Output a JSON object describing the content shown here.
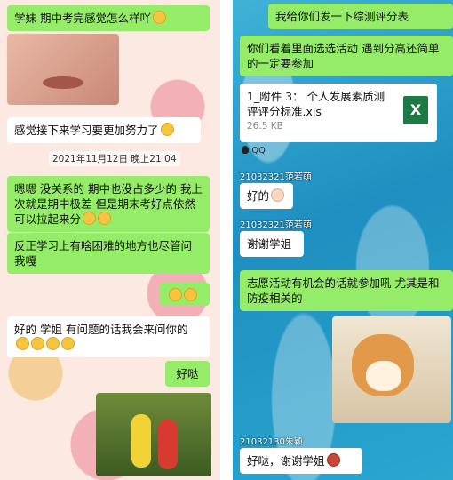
{
  "left": {
    "msg1": "学妹 期中考完感觉怎么样吖",
    "msg2": "感觉接下来学习要更加努力了",
    "timestamp": "2021年11月12日 晚上21:04",
    "msg3": "嗯嗯 没关系的 期中也没占多少的 我上次就是期中极差 但是期末考好点依然可以拉起来分",
    "msg4": "反正学习上有啥困难的地方也尽管问我嘎",
    "msg5": "好的 学姐 有问题的话我会来问你的",
    "msg6": "好哒"
  },
  "right": {
    "msg1": "我给你们发一下综测评分表",
    "msg2": "你们看着里面选选活动 遇到分高还简单的一定要参加",
    "file": {
      "name": "1_附件 3： 个人发展素质测评评分标准.xls",
      "size": "26.5 KB",
      "icon_label": "X",
      "source": "QQ"
    },
    "user1": "21032321范若萌",
    "reply1": "好的",
    "user2": "21032321范若萌",
    "reply2": "谢谢学姐",
    "msg3": "志愿活动有机会的话就参加吼 尤其是和防疫相关的",
    "user3": "21032130朱颖",
    "reply3": "好哒，谢谢学姐"
  }
}
